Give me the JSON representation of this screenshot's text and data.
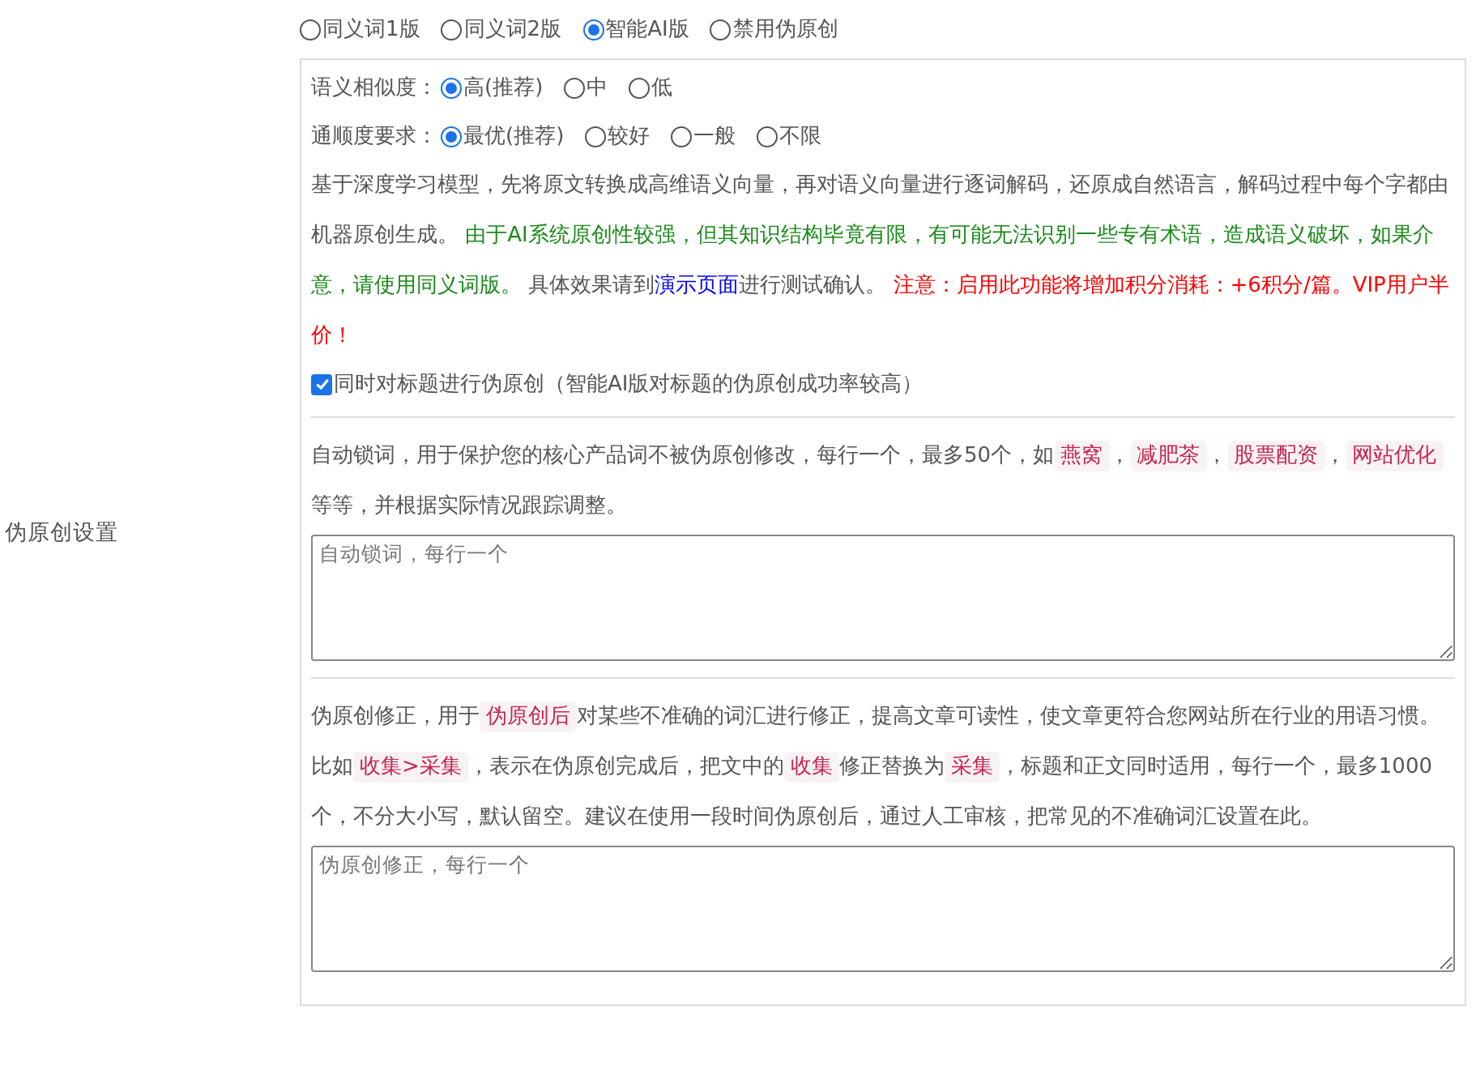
{
  "settings_label": "伪原创设置",
  "mode_options": [
    {
      "label": "同义词1版",
      "selected": false
    },
    {
      "label": "同义词2版",
      "selected": false
    },
    {
      "label": "智能AI版",
      "selected": true
    },
    {
      "label": "禁用伪原创",
      "selected": false
    }
  ],
  "similarity": {
    "label": "语义相似度：",
    "options": [
      {
        "label": "高(推荐)",
        "selected": true
      },
      {
        "label": "中",
        "selected": false
      },
      {
        "label": "低",
        "selected": false
      }
    ]
  },
  "fluency": {
    "label": "通顺度要求：",
    "options": [
      {
        "label": "最优(推荐)",
        "selected": true
      },
      {
        "label": "较好",
        "selected": false
      },
      {
        "label": "一般",
        "selected": false
      },
      {
        "label": "不限",
        "selected": false
      }
    ]
  },
  "ai_description": [
    {
      "kind": "text",
      "text": "基于深度学习模型，先将原文转换成高维语义向量，再对语义向量进行逐词解码，还原成自然语言，解码过程中每个字都由机器原创生成。 "
    },
    {
      "kind": "green",
      "text": "由于AI系统原创性较强，但其知识结构毕竟有限，有可能无法识别一些专有术语，造成语义破坏，如果介意，请使用同义词版。"
    },
    {
      "kind": "text",
      "text": " 具体效果请到"
    },
    {
      "kind": "link",
      "text": "演示页面"
    },
    {
      "kind": "text",
      "text": "进行测试确认。 "
    },
    {
      "kind": "red",
      "text": "注意：启用此功能将增加积分消耗：+6积分/篇。VIP用户半价！"
    }
  ],
  "title_option": {
    "label": "同时对标题进行伪原创（智能AI版对标题的伪原创成功率较高）",
    "checked": true
  },
  "lock_words": {
    "description": [
      {
        "kind": "text",
        "text": "自动锁词，用于保护您的核心产品词不被伪原创修改，每行一个，最多50个，如"
      },
      {
        "kind": "tag",
        "text": "燕窝"
      },
      {
        "kind": "text",
        "text": "，"
      },
      {
        "kind": "tag",
        "text": "减肥茶"
      },
      {
        "kind": "text",
        "text": "，"
      },
      {
        "kind": "tag",
        "text": "股票配资"
      },
      {
        "kind": "text",
        "text": "，"
      },
      {
        "kind": "tag",
        "text": "网站优化"
      },
      {
        "kind": "text",
        "text": " 等等，并根据实际情况跟踪调整。"
      }
    ],
    "placeholder": "自动锁词，每行一个"
  },
  "corrections": {
    "description": [
      {
        "kind": "text",
        "text": "伪原创修正，用于"
      },
      {
        "kind": "tag",
        "text": "伪原创后"
      },
      {
        "kind": "text",
        "text": "对某些不准确的词汇进行修正，提高文章可读性，使文章更符合您网站所在行业的用语习惯。比如"
      },
      {
        "kind": "tag",
        "text": "收集>采集"
      },
      {
        "kind": "text",
        "text": "，表示在伪原创完成后，把文中的"
      },
      {
        "kind": "tag",
        "text": "收集"
      },
      {
        "kind": "text",
        "text": "修正替换为"
      },
      {
        "kind": "tag",
        "text": "采集"
      },
      {
        "kind": "text",
        "text": "，标题和正文同时适用，每行一个，最多1000个，不分大小写，默认留空。建议在使用一段时间伪原创后，通过人工审核，把常见的不准确词汇设置在此。"
      }
    ],
    "placeholder": "伪原创修正，每行一个"
  }
}
